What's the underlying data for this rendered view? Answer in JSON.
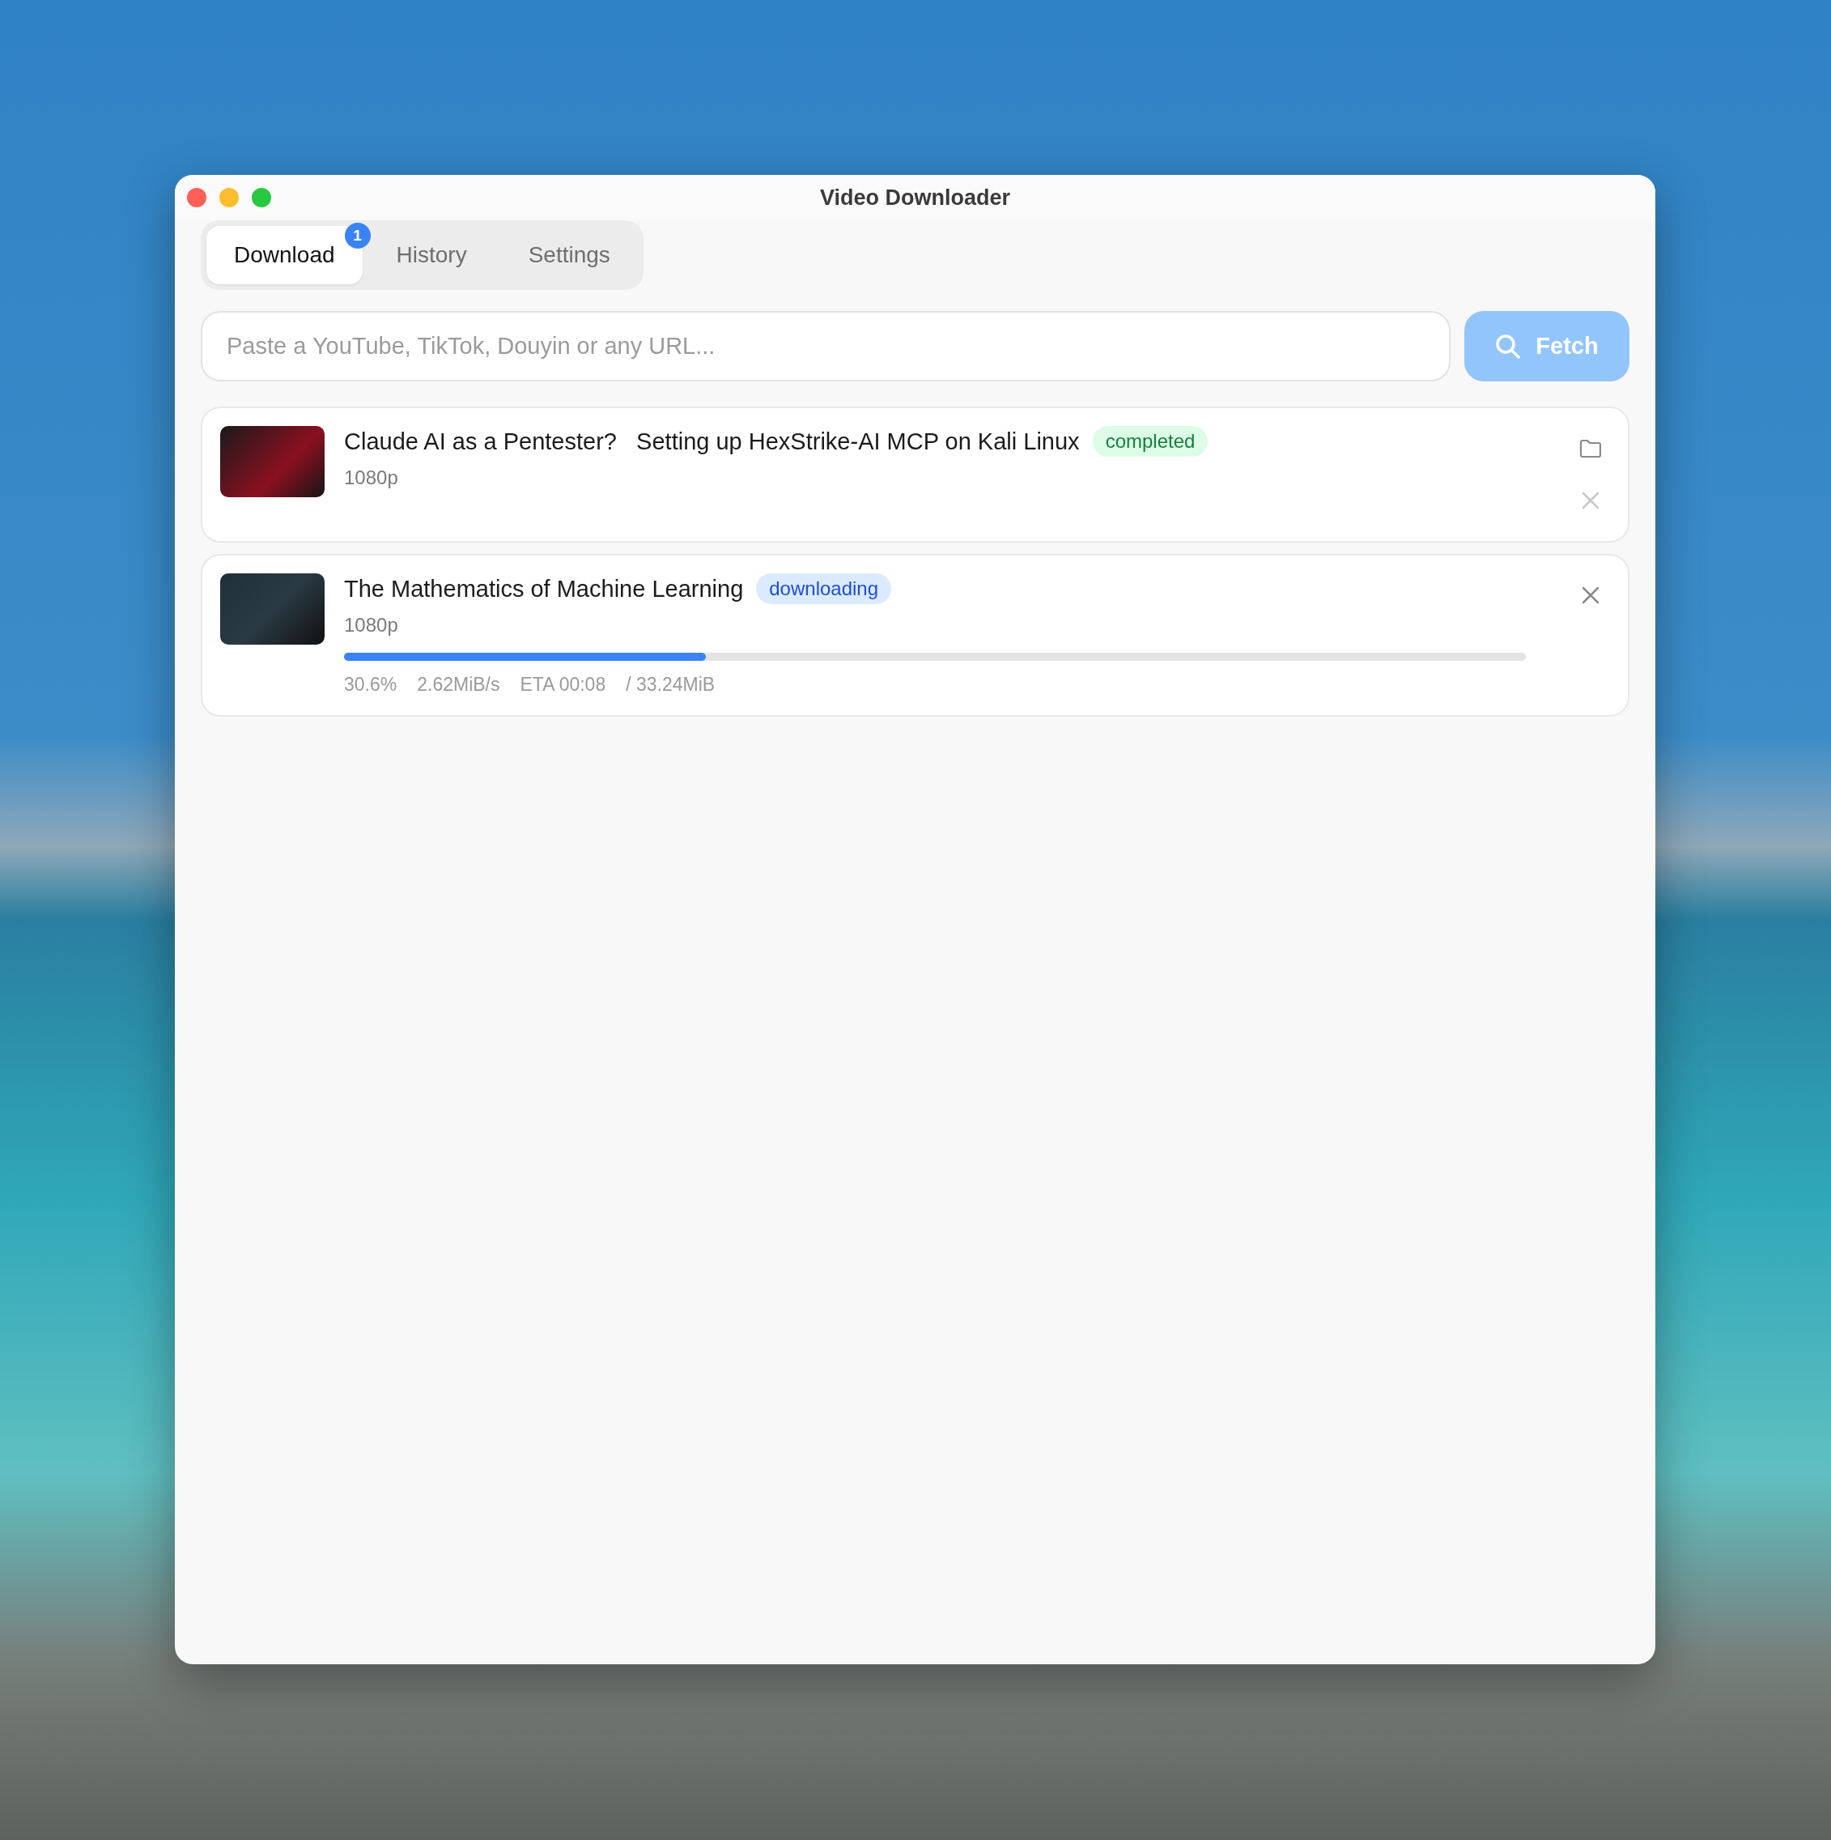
{
  "window": {
    "title": "Video Downloader"
  },
  "tabs": [
    {
      "label": "Download",
      "selected": true,
      "badge": "1"
    },
    {
      "label": "History",
      "selected": false
    },
    {
      "label": "Settings",
      "selected": false
    }
  ],
  "url_field": {
    "placeholder": "Paste a YouTube, TikTok, Douyin or any URL..."
  },
  "fetch_button": {
    "label": "Fetch",
    "disabled": true
  },
  "downloads": [
    {
      "kind": "completed",
      "title": "Claude AI as a Pentester?   Setting up HexStrike-AI MCP on Kali Linux",
      "status": "completed",
      "quality": "1080p"
    },
    {
      "kind": "downloading",
      "title": "The Mathematics of Machine Learning",
      "status": "downloading",
      "quality": "1080p",
      "level": 0.306,
      "stats": [
        "30.6%",
        "2.62MiB/s",
        "ETA 00:08",
        "/ 33.24MiB"
      ]
    }
  ]
}
